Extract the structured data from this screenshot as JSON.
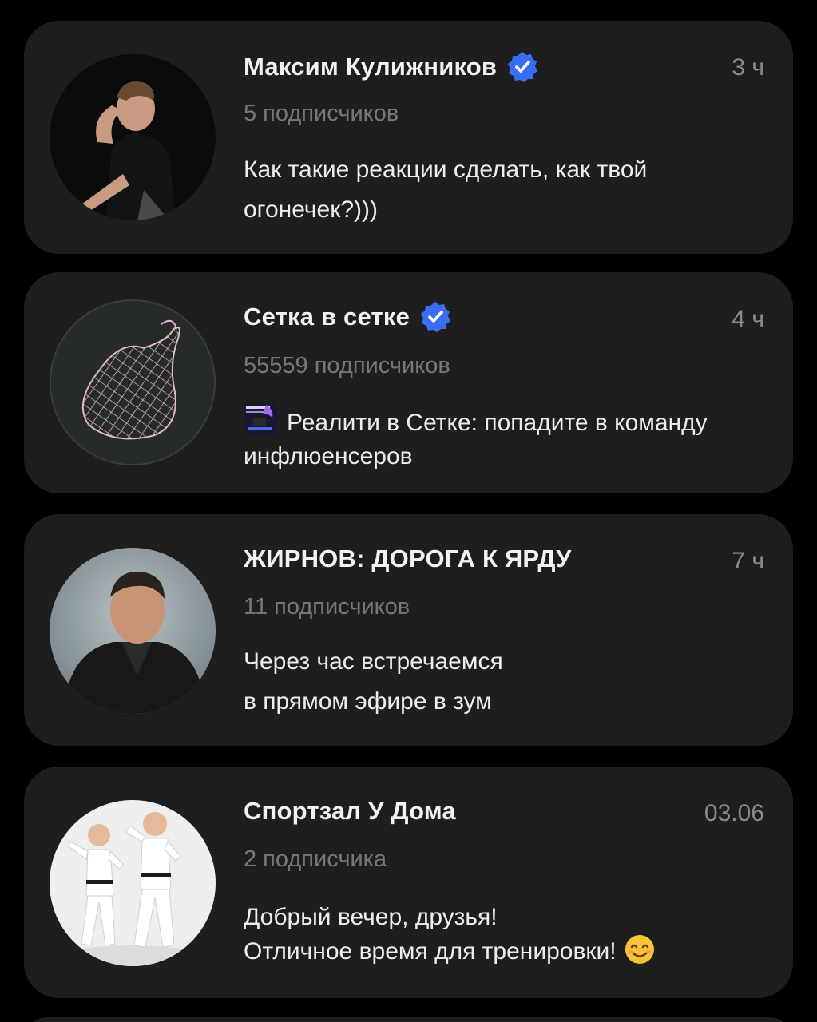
{
  "feed": {
    "items": [
      {
        "name": "Максим Кулижников",
        "verified": true,
        "time": "3 ч",
        "subscribers": "5 подписчиков",
        "message_lines": [
          "Как такие реакции сделать, как твой",
          "огонечек?)))"
        ],
        "avatar_icon": "person-photo"
      },
      {
        "name": "Сетка в сетке",
        "verified": true,
        "time": "4 ч",
        "subscribers": "55559 подписчиков",
        "message_lines": [
          "Реалити в Сетке: попадите в команду",
          "инфлюенсеров"
        ],
        "avatar_icon": "net-bag-logo",
        "message_thumbnail": "video-thumbnail"
      },
      {
        "name": "ЖИРНОВ: ДОРОГА К ЯРДУ",
        "verified": false,
        "time": "7 ч",
        "subscribers": "11 подписчиков",
        "message_lines": [
          "Через час встречаемся",
          "в прямом эфире в зум"
        ],
        "avatar_icon": "person-photo"
      },
      {
        "name": "Спортзал У Дома",
        "verified": false,
        "time": "03.06",
        "subscribers": "2 подписчика",
        "message_lines": [
          "Добрый вечер, друзья!",
          "Отличное время для тренировки!"
        ],
        "message_emoji": "smiling-face-emoji",
        "avatar_icon": "kids-karate-photo"
      }
    ]
  },
  "colors": {
    "background": "#000000",
    "card": "#1e1e1e",
    "name_text": "#f2f2f2",
    "secondary_text": "#777777",
    "verified_badge": "#3b6cf5"
  }
}
